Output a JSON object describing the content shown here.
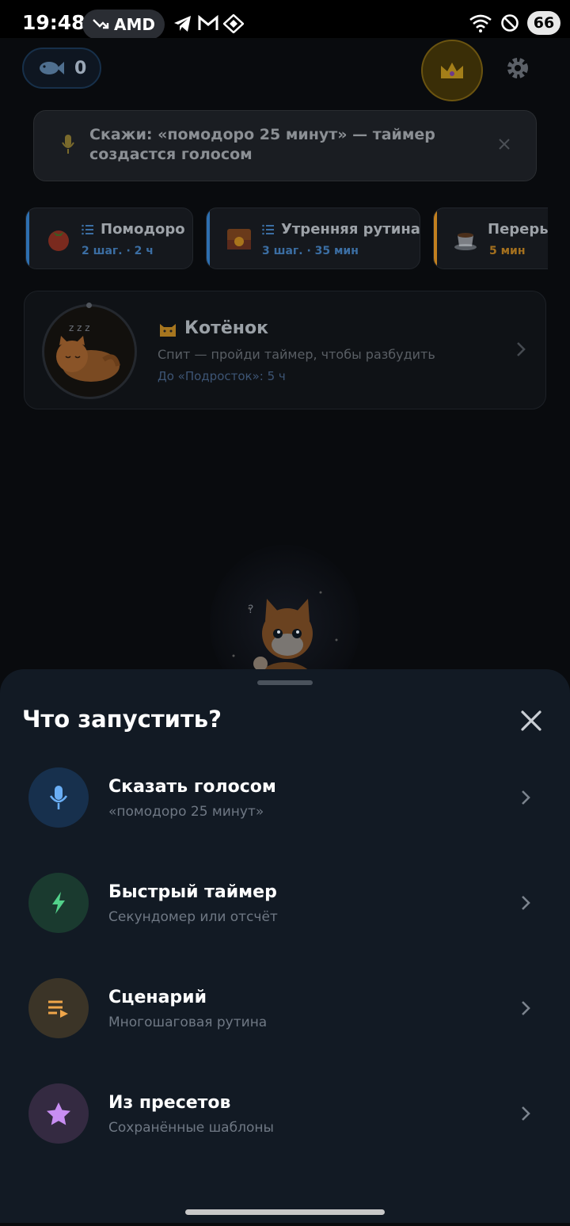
{
  "status_bar": {
    "time": "19:48",
    "pill_label": "AMD",
    "battery": "66"
  },
  "header": {
    "fish_count": "0"
  },
  "voice_banner": {
    "text": "Скажи: «помодоро 25 минут» — таймер создастся голосом"
  },
  "presets": [
    {
      "title": "Помодоро",
      "sub": "2 шаг. · 2 ч",
      "accent": "#2d6fb0",
      "sub_color": "#3b6ea3"
    },
    {
      "title": "Утренняя рутина",
      "sub": "3 шаг. · 35 мин",
      "accent": "#2d6fb0",
      "sub_color": "#3b6ea3"
    },
    {
      "title": "Переры",
      "sub": "5 мин",
      "accent": "#c2801f",
      "sub_color": "#a4701e"
    }
  ],
  "pet": {
    "name": "Котёнок",
    "status": "Спит — пройди таймер, чтобы разбудить",
    "next_stage": "До «Подросток»: 5 ч"
  },
  "sheet": {
    "title": "Что запустить?",
    "options": [
      {
        "label": "Сказать голосом",
        "desc": "«помодоро 25 минут»",
        "icon": "mic-icon",
        "color": "#17304d"
      },
      {
        "label": "Быстрый таймер",
        "desc": "Секундомер или отсчёт",
        "icon": "lightning-icon",
        "color": "#1a3a2f"
      },
      {
        "label": "Сценарий",
        "desc": "Многошаговая рутина",
        "icon": "playlist-icon",
        "color": "#3b3427"
      },
      {
        "label": "Из пресетов",
        "desc": "Сохранённые шаблоны",
        "icon": "star-icon",
        "color": "#342a41"
      }
    ]
  }
}
